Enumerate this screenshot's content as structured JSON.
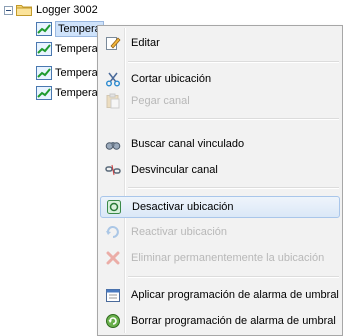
{
  "tree": {
    "root_label": "Logger 3002",
    "children": [
      {
        "label": "Tempera"
      },
      {
        "label": "Tempera"
      },
      {
        "label": "Tempera"
      },
      {
        "label": "Tempera"
      }
    ]
  },
  "context_menu": {
    "items": [
      {
        "label": "Editar",
        "icon": "edit-icon",
        "enabled": true
      },
      {
        "label": "Cortar ubicación",
        "icon": "cut-icon",
        "enabled": true
      },
      {
        "label": "Pegar canal",
        "icon": "paste-icon",
        "enabled": false
      },
      {
        "label": "Buscar canal vinculado",
        "icon": "binoculars-icon",
        "enabled": true
      },
      {
        "label": "Desvincular canal",
        "icon": "unlink-icon",
        "enabled": true
      },
      {
        "label": "Desactivar ubicación",
        "icon": "deactivate-icon",
        "enabled": true,
        "highlighted": true
      },
      {
        "label": "Reactivar ubicación",
        "icon": "reactivate-icon",
        "enabled": false
      },
      {
        "label": "Eliminar permanentemente la ubicación",
        "icon": "delete-icon",
        "enabled": false
      },
      {
        "label": "Aplicar programación de alarma de umbral",
        "icon": "calendar-icon",
        "enabled": true
      },
      {
        "label": "Borrar programación de alarma de umbral",
        "icon": "clear-schedule-icon",
        "enabled": true
      }
    ]
  }
}
